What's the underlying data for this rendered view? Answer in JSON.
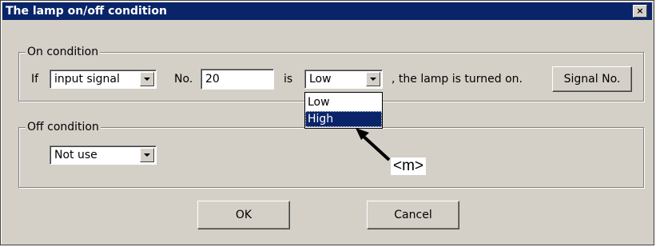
{
  "window": {
    "title": "The lamp on/off condition",
    "close_glyph": "×"
  },
  "on_condition": {
    "group_label": "On condition",
    "if_label": "If",
    "source_value": "input signal",
    "no_label": "No.",
    "number_value": "20",
    "is_label": "is",
    "state_value": "Low",
    "suffix_label": ", the lamp is turned on.",
    "signal_no_button": "Signal No.",
    "dropdown_options": [
      "Low",
      "High"
    ],
    "dropdown_highlighted": "High"
  },
  "off_condition": {
    "group_label": "Off condition",
    "mode_value": "Not use"
  },
  "buttons": {
    "ok": "OK",
    "cancel": "Cancel"
  },
  "annotation": {
    "label": "<m>"
  },
  "colors": {
    "title_bar": "#0a246a",
    "dialog_face": "#d4d0c8",
    "selection": "#0a246a"
  }
}
